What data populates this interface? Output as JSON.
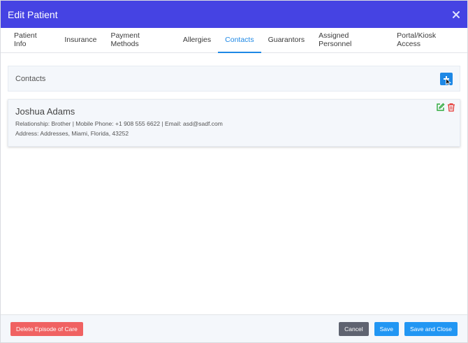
{
  "modal": {
    "title": "Edit Patient"
  },
  "tabs": [
    {
      "label": "Patient Info"
    },
    {
      "label": "Insurance"
    },
    {
      "label": "Payment Methods"
    },
    {
      "label": "Allergies"
    },
    {
      "label": "Contacts",
      "active": true
    },
    {
      "label": "Guarantors"
    },
    {
      "label": "Assigned Personnel"
    },
    {
      "label": "Portal/Kiosk Access"
    }
  ],
  "contacts_section": {
    "title": "Contacts"
  },
  "contact": {
    "name": "Joshua Adams",
    "details": "Relationship: Brother | Mobile Phone: +1 908 555 6622 | Email: asd@sadf.com",
    "address": "Address: Addresses, Miami, Florida, 43252"
  },
  "footer": {
    "delete_label": "Delete Episode of Care",
    "cancel_label": "Cancel",
    "save_label": "Save",
    "save_close_label": "Save and Close"
  },
  "colors": {
    "header": "#4543e3",
    "accent": "#1e88e5",
    "danger": "#f06262",
    "edit": "#2eaa3c",
    "delete": "#e53935"
  },
  "icons": [
    "close-icon",
    "plus-icon",
    "cursor-icon",
    "edit-icon",
    "trash-icon"
  ]
}
